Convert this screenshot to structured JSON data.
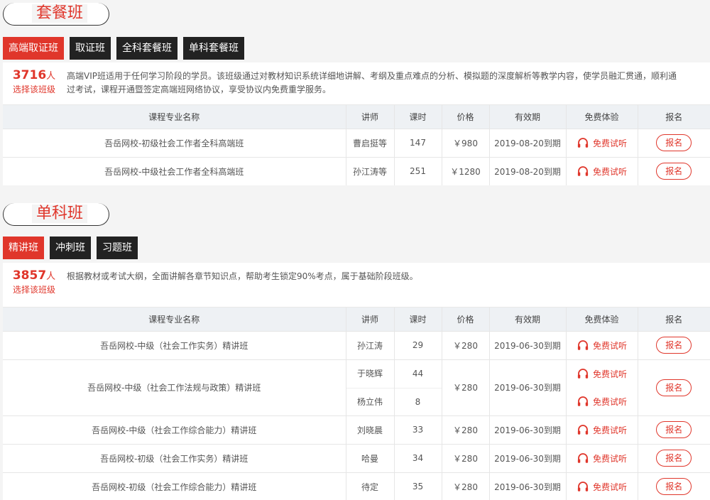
{
  "sections": [
    {
      "title": "套餐班",
      "tabs": [
        "高端取证班",
        "取证班",
        "全科套餐班",
        "单科套餐班"
      ],
      "active_tab": 0,
      "count": "3716",
      "count_unit": "人",
      "count_label": "选择该班级",
      "description": "高端VIP班适用于任何学习阶段的学员。该班级通过对教材知识系统详细地讲解、考纲及重点难点的分析、模拟题的深度解析等教学内容，使学员融汇贯通，顺利通过考试，课程开通暨签定高端班网络协议，享受协议内免费重学服务。",
      "columns": [
        "课程专业名称",
        "讲师",
        "课时",
        "价格",
        "有效期",
        "免费体验",
        "报名"
      ],
      "rows": [
        {
          "name": "吾岳网校-初级社会工作者全科高端班",
          "teachers": [
            "曹启挺等"
          ],
          "hours": [
            "147"
          ],
          "price": "￥980",
          "expiry": "2019-08-20到期",
          "trials": [
            "免费试听"
          ],
          "signup": "报名"
        },
        {
          "name": "吾岳网校-中级社会工作者全科高端班",
          "teachers": [
            "孙江涛等"
          ],
          "hours": [
            "251"
          ],
          "price": "￥1280",
          "expiry": "2019-08-20到期",
          "trials": [
            "免费试听"
          ],
          "signup": "报名"
        }
      ]
    },
    {
      "title": "单科班",
      "tabs": [
        "精讲班",
        "冲刺班",
        "习题班"
      ],
      "active_tab": 0,
      "count": "3857",
      "count_unit": "人",
      "count_label": "选择该班级",
      "description": "根据教材或考试大纲，全面讲解各章节知识点，帮助考生锁定90%考点，属于基础阶段班级。",
      "columns": [
        "课程专业名称",
        "讲师",
        "课时",
        "价格",
        "有效期",
        "免费体验",
        "报名"
      ],
      "rows": [
        {
          "name": "吾岳网校-中级（社会工作实务）精讲班",
          "teachers": [
            "孙江涛"
          ],
          "hours": [
            "29"
          ],
          "price": "￥280",
          "expiry": "2019-06-30到期",
          "trials": [
            "免费试听"
          ],
          "signup": "报名"
        },
        {
          "name": "吾岳网校-中级（社会工作法规与政策）精讲班",
          "teachers": [
            "于晓辉",
            "杨立伟"
          ],
          "hours": [
            "44",
            "8"
          ],
          "price": "￥280",
          "expiry": "2019-06-30到期",
          "trials": [
            "免费试听",
            "免费试听"
          ],
          "signup": "报名"
        },
        {
          "name": "吾岳网校-中级（社会工作综合能力）精讲班",
          "teachers": [
            "刘晓晨"
          ],
          "hours": [
            "33"
          ],
          "price": "￥280",
          "expiry": "2019-06-30到期",
          "trials": [
            "免费试听"
          ],
          "signup": "报名"
        },
        {
          "name": "吾岳网校-初级（社会工作实务）精讲班",
          "teachers": [
            "哈曼"
          ],
          "hours": [
            "34"
          ],
          "price": "￥280",
          "expiry": "2019-06-30到期",
          "trials": [
            "免费试听"
          ],
          "signup": "报名"
        },
        {
          "name": "吾岳网校-初级（社会工作综合能力）精讲班",
          "teachers": [
            "待定"
          ],
          "hours": [
            "35"
          ],
          "price": "￥280",
          "expiry": "2019-06-30到期",
          "trials": [
            "免费试听"
          ],
          "signup": "报名"
        }
      ]
    }
  ],
  "icons": {
    "trial": "headphones-icon"
  },
  "colors": {
    "accent": "#e0362b",
    "tab_dark": "#222222",
    "header_bg": "#eef1f4"
  }
}
